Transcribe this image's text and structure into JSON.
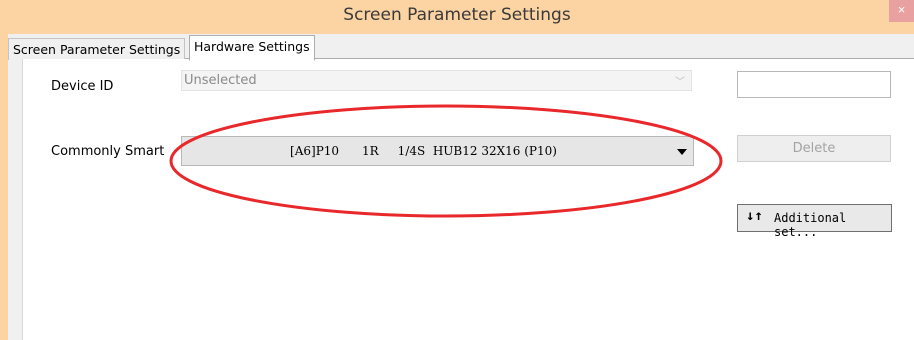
{
  "window": {
    "title": "Screen Parameter Settings",
    "close_glyph": "×"
  },
  "tabs": [
    {
      "label": "Screen Parameter Settings",
      "active": false
    },
    {
      "label": "Hardware Settings",
      "active": true
    }
  ],
  "form": {
    "device_id_label": "Device ID",
    "device_id_value": "Unselected",
    "device_text_value": "",
    "commonly_smart_label": "Commonly Smart",
    "commonly_smart_value": "[A6]P10      1R     1/4S  HUB12 32X16 (P10)",
    "delete_label": "Delete",
    "additional_label": "Additional set...",
    "additional_icon": "up-down-arrows-icon"
  },
  "annotation": {
    "color": "#e8282b"
  }
}
